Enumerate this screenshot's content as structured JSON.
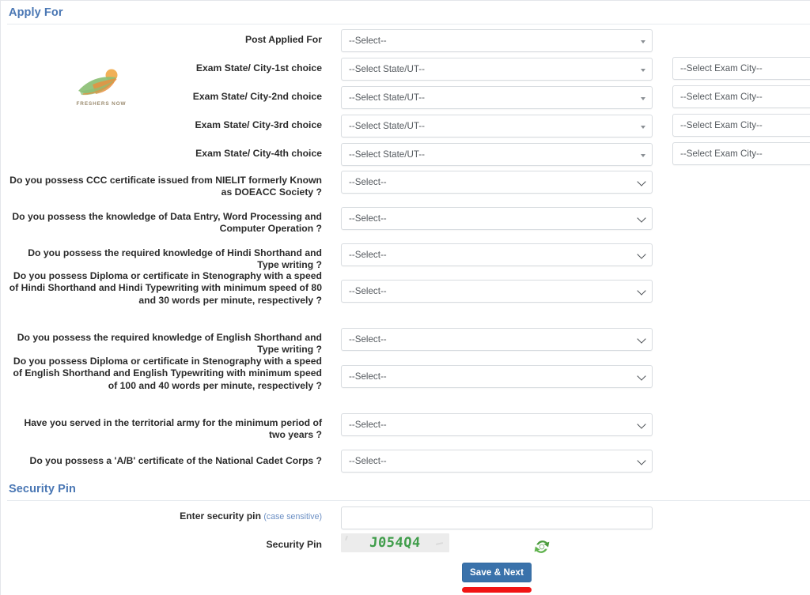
{
  "sections": {
    "apply_for": {
      "title": "Apply For"
    },
    "security_pin": {
      "title": "Security Pin"
    }
  },
  "logo": {
    "wordmark": "FRESHERS NOW",
    "colors": {
      "green": "#8dbf76",
      "orange": "#e8903f",
      "text": "#9a8a6e"
    }
  },
  "watermark": "https://www.freshersnow.com/",
  "choice_rows": [
    {
      "label": "Post Applied For",
      "state_value": "--Select--",
      "has_city": false
    },
    {
      "label": "Exam State/ City-1st choice",
      "state_value": "--Select State/UT--",
      "has_city": true,
      "city_value": "--Select Exam City--"
    },
    {
      "label": "Exam State/ City-2nd choice",
      "state_value": "--Select State/UT--",
      "has_city": true,
      "city_value": "--Select Exam City--"
    },
    {
      "label": "Exam State/ City-3rd choice",
      "state_value": "--Select State/UT--",
      "has_city": true,
      "city_value": "--Select Exam City--"
    },
    {
      "label": "Exam State/ City-4th choice",
      "state_value": "--Select State/UT--",
      "has_city": true,
      "city_value": "--Select Exam City--"
    }
  ],
  "questions": [
    {
      "label": "Do you possess CCC certificate issued from NIELIT formerly Known as DOEACC Society ?",
      "value": "--Select--"
    },
    {
      "label": "Do you possess the knowledge of Data Entry, Word Processing and Computer Operation ?",
      "value": "--Select--"
    },
    {
      "label": "Do you possess the required knowledge of Hindi Shorthand and Type writing ?",
      "value": "--Select--"
    },
    {
      "label": "Do you possess Diploma or certificate in Stenography with a speed of Hindi Shorthand and Hindi Typewriting with minimum speed of 80 and 30 words per minute, respectively ?",
      "value": "--Select--"
    },
    {
      "label": "Do you possess the required knowledge of English Shorthand and Type writing ?",
      "value": "--Select--"
    },
    {
      "label": "Do you possess Diploma or certificate in Stenography with a speed of English Shorthand and English Typewriting with minimum speed of 100 and 40 words per minute, respectively ?",
      "value": "--Select--"
    },
    {
      "label": "Have you served in the territorial army for the minimum period of two years ?",
      "value": "--Select--"
    },
    {
      "label": "Do you possess a 'A/B' certificate of the National Cadet Corps ?",
      "value": "--Select--"
    }
  ],
  "security": {
    "enter_pin_label": "Enter security pin",
    "case_note": "(case sensitive)",
    "pin_input_value": "",
    "pin_label": "Security Pin",
    "captcha_text": "J054Q4",
    "refresh_icon": "refresh-icon"
  },
  "footer": {
    "save_label": "Save & Next"
  },
  "colors": {
    "heading": "#4a77b4",
    "button": "#3a72ab",
    "captcha_green": "#3f9d4a",
    "underline_red": "#f11414",
    "case_note": "#6b8fc4"
  }
}
